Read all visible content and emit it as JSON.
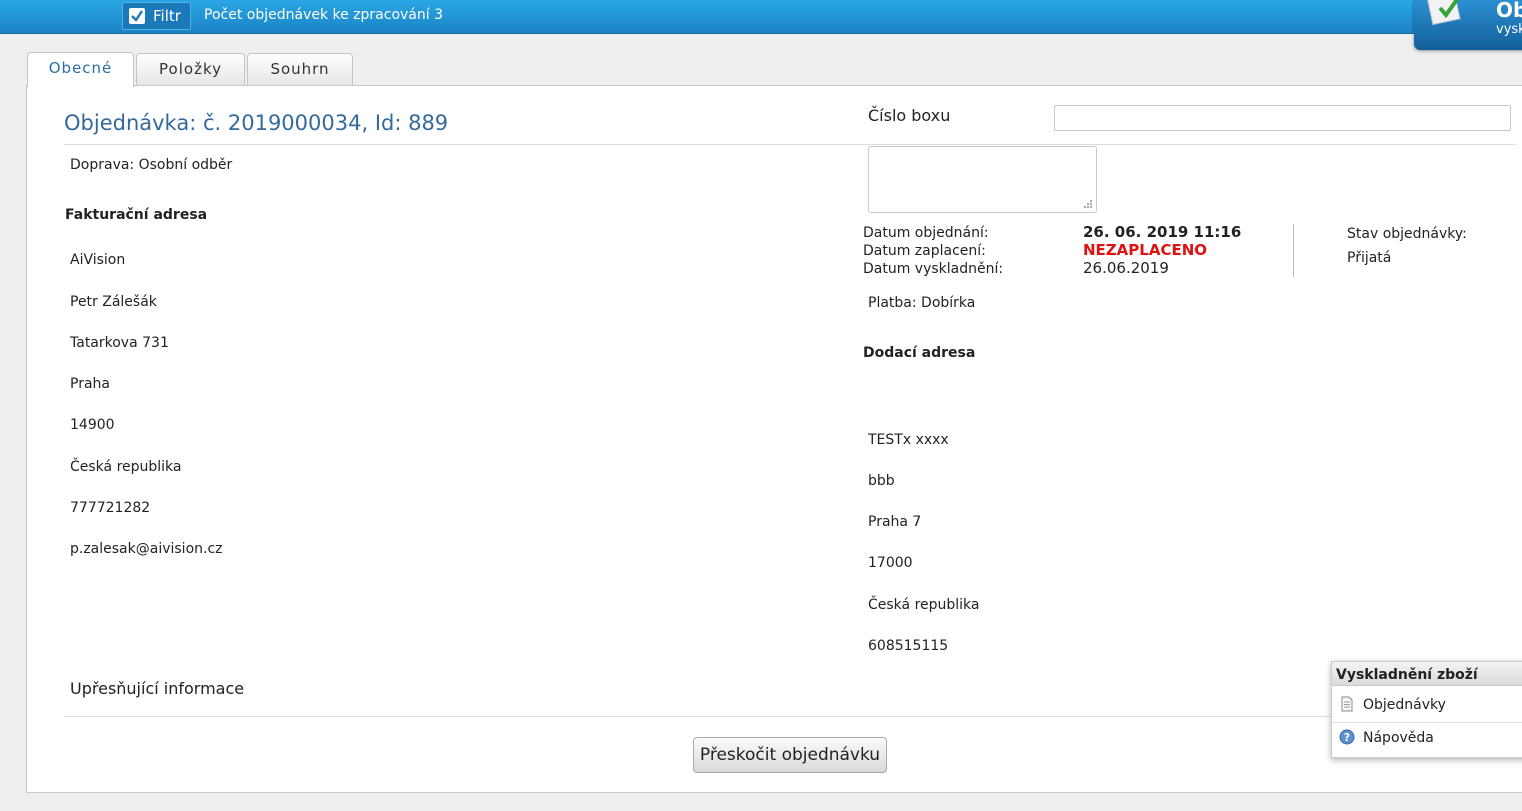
{
  "topbar": {
    "filter_label": "Filtr",
    "count_text": "Počet objednávek ke zpracování 3",
    "corner_title": "Ob",
    "corner_sub": "vysk"
  },
  "tabs": [
    {
      "label": "Obecné",
      "active": true
    },
    {
      "label": "Položky",
      "active": false
    },
    {
      "label": "Souhrn",
      "active": false
    }
  ],
  "order": {
    "title": "Objednávka: č. 2019000034, Id: 889",
    "transport": "Doprava: Osobní odběr",
    "billing_heading": "Fakturační adresa",
    "billing": [
      "AiVision",
      "Petr Zálešák",
      "Tatarkova 731",
      "Praha",
      "14900",
      "Česká republika",
      "777721282",
      "p.zalesak@aivision.cz"
    ],
    "extra_info_label": "Upřesňující informace"
  },
  "box": {
    "label": "Číslo boxu",
    "value": "",
    "note": ""
  },
  "dates": {
    "ordered_label": "Datum objednání:",
    "ordered_value": "26. 06. 2019 11:16",
    "paid_label": "Datum zaplacení:",
    "paid_value": "NEZAPLACENO",
    "shipped_label": "Datum vyskladnění:",
    "shipped_value": "26.06.2019",
    "status_label": "Stav objednávky:",
    "status_value": "Přijatá"
  },
  "payment": "Platba: Dobírka",
  "delivery": {
    "heading": "Dodací adresa",
    "lines": [
      "TESTx xxxx",
      "bbb",
      "Praha 7",
      "17000",
      "Česká republika",
      "608515115"
    ]
  },
  "buttons": {
    "skip": "Přeskočit objednávku"
  },
  "side_menu": {
    "title": "Vyskladnění zboží",
    "items": [
      {
        "label": "Objednávky",
        "icon": "document-icon"
      },
      {
        "label": "Nápověda",
        "icon": "help-icon"
      }
    ]
  },
  "colors": {
    "accent": "#34699c",
    "unpaid": "#e01010",
    "topbar": "#1b83c6"
  }
}
